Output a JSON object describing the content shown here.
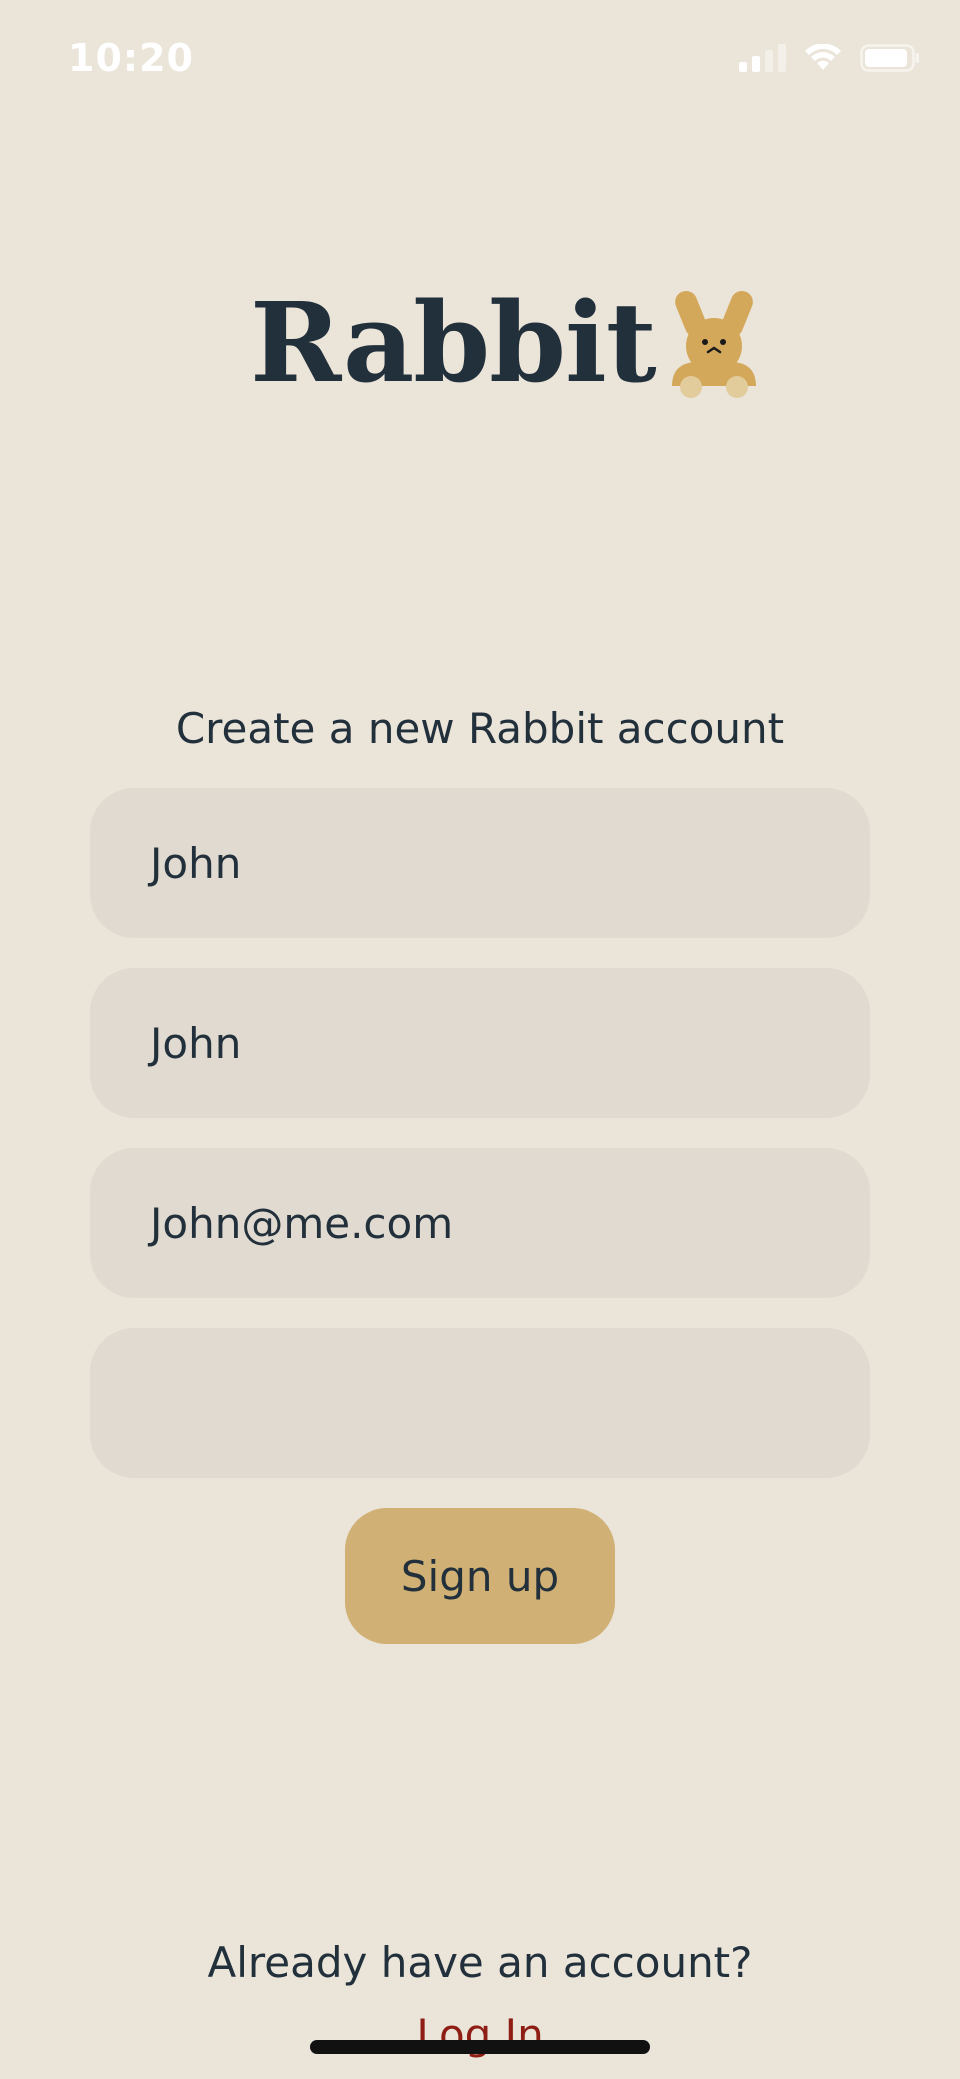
{
  "status_bar": {
    "time": "10:20",
    "icons": [
      "cellular-signal-icon",
      "wifi-icon",
      "battery-icon"
    ]
  },
  "logo": {
    "text": "Rabbit",
    "mascot_icon": "rabbit-mascot-icon"
  },
  "form": {
    "title": "Create a new Rabbit account",
    "fields": [
      {
        "value": "John"
      },
      {
        "value": "John"
      },
      {
        "value": "John@me.com"
      },
      {
        "value": ""
      }
    ],
    "submit_label": "Sign up"
  },
  "footer": {
    "prompt": "Already have an account?",
    "login_label": "Log In"
  },
  "colors": {
    "background": "#EAE4D9",
    "field_bg": "#E1DAD0",
    "button": "#D0B074",
    "text": "#22303C",
    "link": "#8E1E14",
    "mascot": "#D4A85A"
  }
}
